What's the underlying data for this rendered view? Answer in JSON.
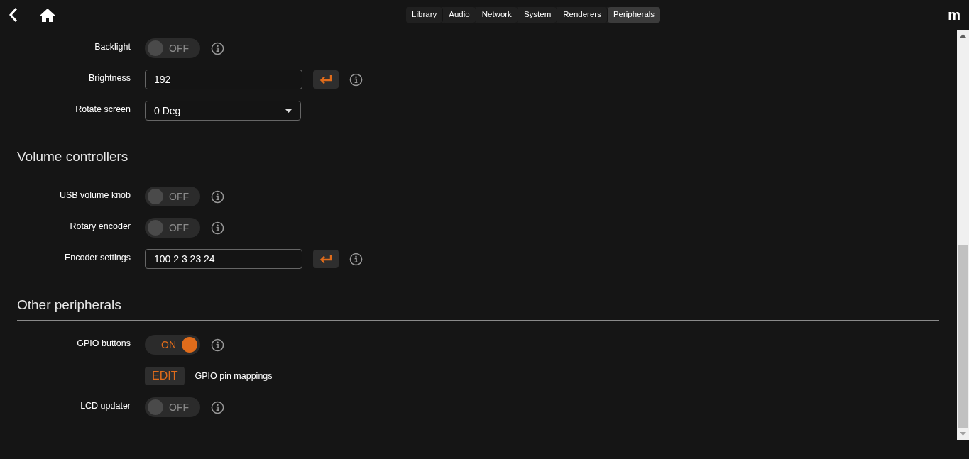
{
  "header": {
    "logo": "m"
  },
  "tabs": [
    {
      "label": "Library",
      "selected": false
    },
    {
      "label": "Audio",
      "selected": false
    },
    {
      "label": "Network",
      "selected": false
    },
    {
      "label": "System",
      "selected": false
    },
    {
      "label": "Renderers",
      "selected": false
    },
    {
      "label": "Peripherals",
      "selected": true
    }
  ],
  "sections": [
    {
      "rows": [
        {
          "kind": "toggle",
          "label": "Backlight",
          "on": false,
          "state_text": "OFF"
        },
        {
          "kind": "input",
          "label": "Brightness",
          "value": "192"
        },
        {
          "kind": "select",
          "label": "Rotate screen",
          "value": "0 Deg"
        }
      ]
    },
    {
      "title": "Volume controllers",
      "rows": [
        {
          "kind": "toggle",
          "label": "USB volume knob",
          "on": false,
          "state_text": "OFF"
        },
        {
          "kind": "toggle",
          "label": "Rotary encoder",
          "on": false,
          "state_text": "OFF"
        },
        {
          "kind": "input",
          "label": "Encoder settings",
          "value": "100 2 3 23 24"
        }
      ]
    },
    {
      "title": "Other peripherals",
      "rows": [
        {
          "kind": "toggle",
          "label": "GPIO buttons",
          "on": true,
          "state_text": "ON"
        },
        {
          "kind": "edit",
          "button": "EDIT",
          "text": "GPIO pin mappings"
        },
        {
          "kind": "toggle",
          "label": "LCD updater",
          "on": false,
          "state_text": "OFF"
        }
      ]
    }
  ]
}
